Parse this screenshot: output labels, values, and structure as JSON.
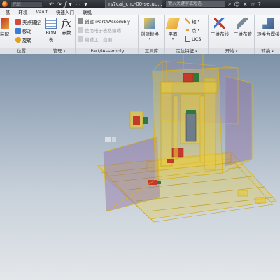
{
  "titlebar": {
    "quick_input": "光纸",
    "doc_title": "rs7cai_cnc-00-setup.i...",
    "search_placeholder": "键入关键字或短语"
  },
  "menu": [
    "基",
    "环境",
    "Vault",
    "快速入门",
    "联机"
  ],
  "ribbon": {
    "position_panel": {
      "label": "位置",
      "place_button": "装配",
      "grip_snap": "夹点捕捉",
      "move": "移动",
      "rotate": "旋转"
    },
    "manage_panel": {
      "label": "管理",
      "bom": "BOM",
      "bom_sub": "表",
      "params": "参数"
    },
    "ipart_panel": {
      "label": "iPart/iAssembly",
      "create": "创建 iPart/iAssembly",
      "use_sheet": "使用电子表格编辑",
      "edit_factory": "编辑工厂范围"
    },
    "productivity_panel": {
      "label": "工具库",
      "create_substitute": "创建替换"
    },
    "workfeature_panel": {
      "label": "定位特征",
      "plane": "平面",
      "axis": "轴",
      "point": "点",
      "ucs": "UCS"
    },
    "start_panel": {
      "label": "开始",
      "route_3d": "三维布线",
      "tube_3d": "三维布管"
    },
    "convert_panel": {
      "label": "转换",
      "convert_weld": "转换为焊接"
    }
  },
  "colors": {
    "frame_fill": "#e8ca3e",
    "frame_stroke": "#d9b21a",
    "panel_purple": "#8f6fa2",
    "motor_red": "#c43a2a",
    "motor_green": "#2f7a3a",
    "viewport_top": "#7c91a8",
    "viewport_bottom": "#e4e7ea"
  }
}
